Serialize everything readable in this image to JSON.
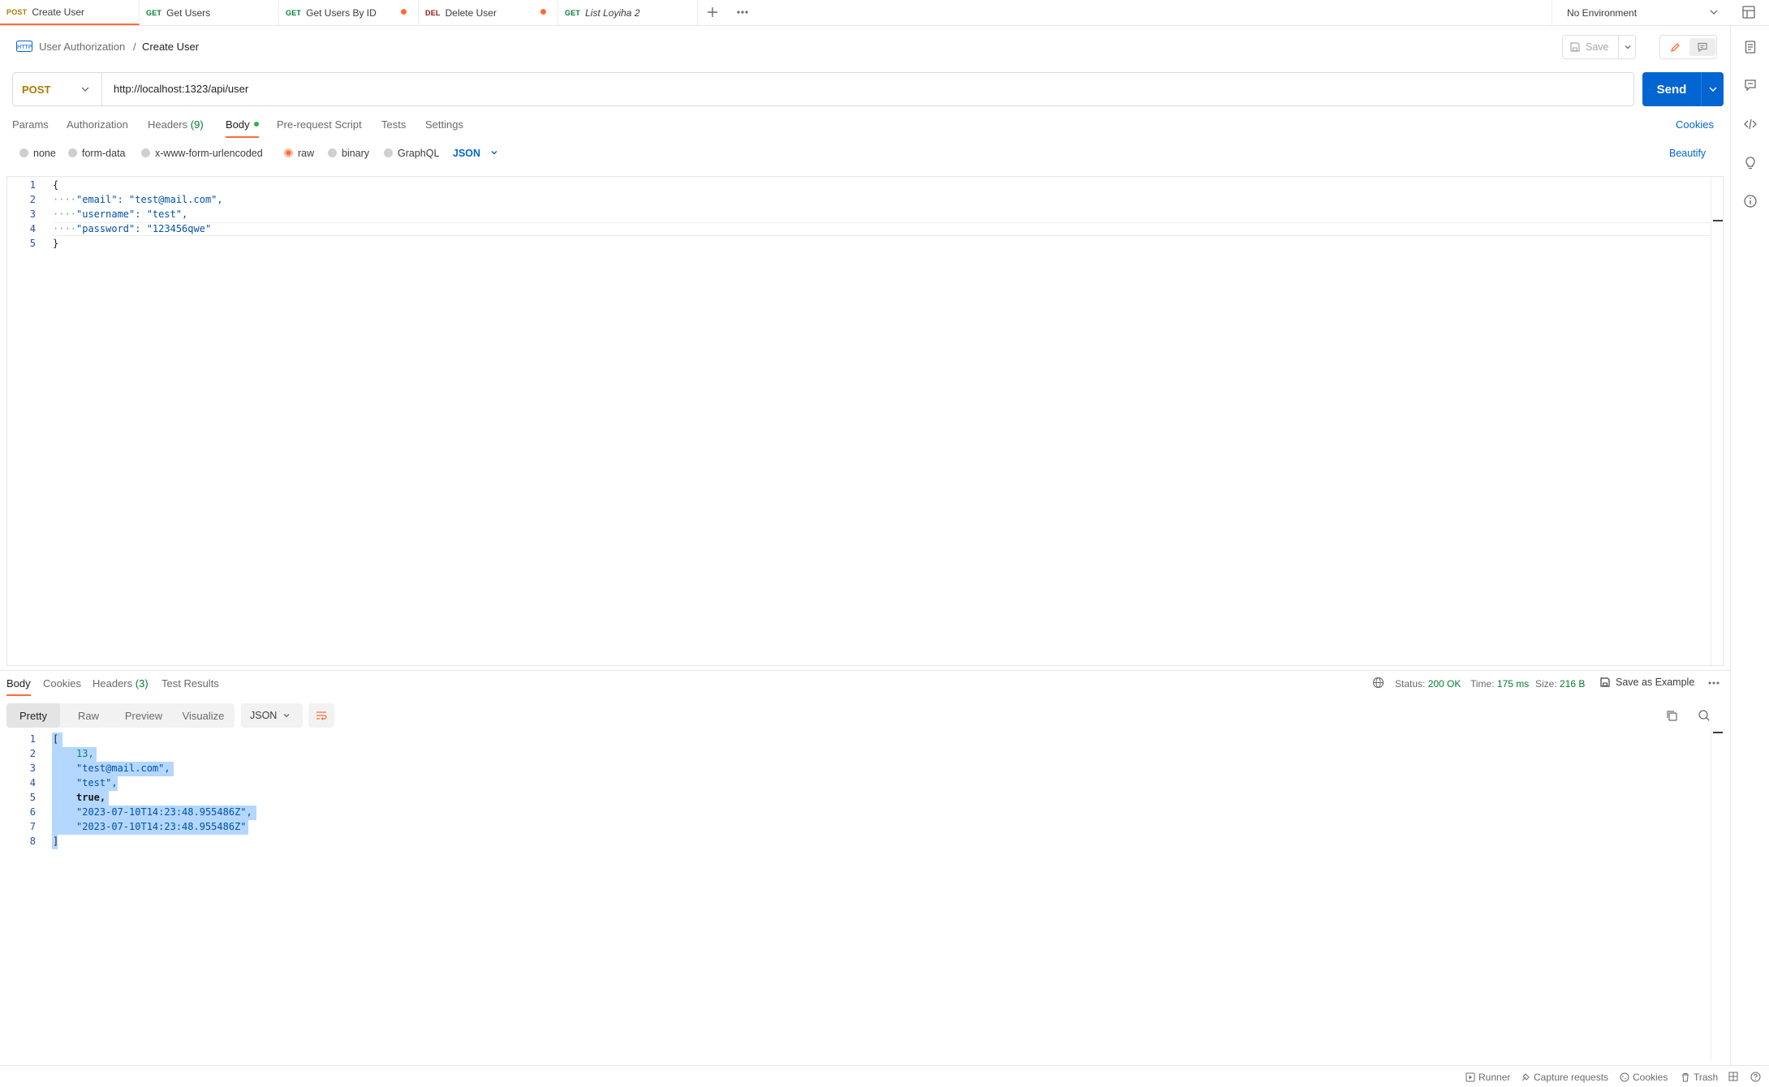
{
  "tabs": [
    {
      "method": "POST",
      "name": "Create User",
      "active": true,
      "unsaved": false
    },
    {
      "method": "GET",
      "name": "Get Users",
      "active": false,
      "unsaved": false
    },
    {
      "method": "GET",
      "name": "Get Users By ID",
      "active": false,
      "unsaved": true
    },
    {
      "method": "DEL",
      "name": "Delete User",
      "active": false,
      "unsaved": true
    },
    {
      "method": "GET",
      "name": "List Loyiha 2",
      "active": false,
      "unsaved": false
    }
  ],
  "environment": "No Environment",
  "breadcrumb": {
    "collection": "User Authorization",
    "separator": "/",
    "request": "Create User"
  },
  "toolbar": {
    "save_label": "Save"
  },
  "request": {
    "method": "POST",
    "url": "http://localhost:1323/api/user",
    "send_label": "Send",
    "tabs": [
      "Params",
      "Authorization",
      "Headers",
      "Body",
      "Pre-request Script",
      "Tests",
      "Settings"
    ],
    "headers_count": "(9)",
    "cookies_label": "Cookies",
    "beautify_label": "Beautify",
    "body_types": [
      "none",
      "form-data",
      "x-www-form-urlencoded",
      "raw",
      "binary",
      "GraphQL"
    ],
    "body_format": "JSON",
    "body_lines": [
      "{",
      "\"email\": \"test@mail.com\",",
      "\"username\": \"test\",",
      "\"password\": \"123456qwe\"",
      "}"
    ]
  },
  "response": {
    "tabs": [
      "Body",
      "Cookies",
      "Headers",
      "Test Results"
    ],
    "headers_count": "(3)",
    "status_label": "Status:",
    "status_value": "200 OK",
    "time_label": "Time:",
    "time_value": "175 ms",
    "size_label": "Size:",
    "size_value": "216 B",
    "save_example_label": "Save as Example",
    "views": [
      "Pretty",
      "Raw",
      "Preview",
      "Visualize"
    ],
    "format": "JSON",
    "body_lines": [
      "[",
      "13,",
      "\"test@mail.com\",",
      "\"test\",",
      "true,",
      "\"2023-07-10T14:23:48.955486Z\",",
      "\"2023-07-10T14:23:48.955486Z\"",
      "]"
    ]
  },
  "statusbar": [
    "Runner",
    "Capture requests",
    "Cookies",
    "Trash"
  ],
  "colors": {
    "accent": "#ff6c37",
    "send": "#0265d2",
    "status_ok": "#007f31"
  }
}
